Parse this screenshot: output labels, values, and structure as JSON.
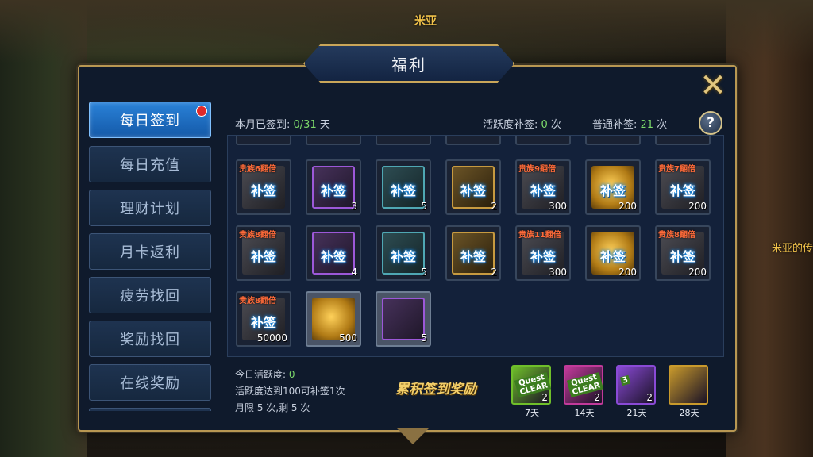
{
  "npc": {
    "name": "米亚",
    "side_text": "米亚的传"
  },
  "dialog": {
    "title": "福利",
    "close_icon": "close-x-icon"
  },
  "tabs": [
    {
      "label": "每日签到",
      "active": true,
      "badge": true
    },
    {
      "label": "每日充值"
    },
    {
      "label": "理财计划"
    },
    {
      "label": "月卡返利"
    },
    {
      "label": "疲劳找回"
    },
    {
      "label": "奖励找回"
    },
    {
      "label": "在线奖励"
    }
  ],
  "stats": {
    "signed_label": "本月已签到: ",
    "signed_value": "0/31",
    "signed_unit": " 天",
    "active_label": "活跃度补签: ",
    "active_value": "0",
    "active_unit": " 次",
    "normal_label": "普通补签: ",
    "normal_value": "21",
    "normal_unit": " 次",
    "help": "?"
  },
  "grid": {
    "rows": [
      [
        {
          "icon": "dark-chest",
          "vip": "贵族6翻倍",
          "stamp": "补签",
          "qty": ""
        },
        {
          "icon": "purple-gear",
          "vip": "",
          "stamp": "补签",
          "qty": "3"
        },
        {
          "icon": "teal-potion",
          "vip": "",
          "stamp": "补签",
          "qty": "5"
        },
        {
          "icon": "bronze-scroll",
          "vip": "",
          "stamp": "补签",
          "qty": "2"
        },
        {
          "icon": "dark-fish",
          "vip": "贵族9翻倍",
          "stamp": "补签",
          "qty": "300"
        },
        {
          "icon": "gold-coin",
          "vip": "",
          "stamp": "补签",
          "qty": "200"
        },
        {
          "icon": "dark-fish",
          "vip": "贵族7翻倍",
          "stamp": "补签",
          "qty": "200"
        }
      ],
      [
        {
          "icon": "dark-chest",
          "vip": "贵族8翻倍",
          "stamp": "补签",
          "qty": ""
        },
        {
          "icon": "purple-gear",
          "vip": "",
          "stamp": "补签",
          "qty": "4"
        },
        {
          "icon": "teal-potion",
          "vip": "",
          "stamp": "补签",
          "qty": "5"
        },
        {
          "icon": "bronze-scroll",
          "vip": "",
          "stamp": "补签",
          "qty": "2"
        },
        {
          "icon": "dark-fish",
          "vip": "贵族11翻倍",
          "stamp": "补签",
          "qty": "300"
        },
        {
          "icon": "gold-coin",
          "vip": "",
          "stamp": "补签",
          "qty": "200"
        },
        {
          "icon": "dark-fish",
          "vip": "贵族8翻倍",
          "stamp": "补签",
          "qty": "200"
        }
      ],
      [
        {
          "icon": "dark-chest",
          "vip": "贵族8翻倍",
          "stamp": "补签",
          "qty": "50000"
        },
        {
          "icon": "gold-coin",
          "vip": "",
          "stamp": "",
          "qty": "500"
        },
        {
          "icon": "purple-cube",
          "vip": "",
          "stamp": "",
          "qty": "5"
        }
      ]
    ]
  },
  "info": {
    "today_label": "今日活跃度: ",
    "today_value": "0",
    "line2": "活跃度达到100可补签1次",
    "line3": "月限 5 次,剩 5 次"
  },
  "rewards": {
    "title": "累积签到奖励",
    "items": [
      {
        "label": "7天",
        "qty": "2",
        "tag": "Quest CLEAR",
        "color": "#6fbf2a"
      },
      {
        "label": "14天",
        "qty": "2",
        "tag": "Quest CLEAR",
        "color": "#c23a9a"
      },
      {
        "label": "21天",
        "qty": "2",
        "tag": "3",
        "color": "#8a4ad6"
      },
      {
        "label": "28天",
        "qty": "",
        "tag": "",
        "color": "#c99a2c"
      }
    ]
  }
}
